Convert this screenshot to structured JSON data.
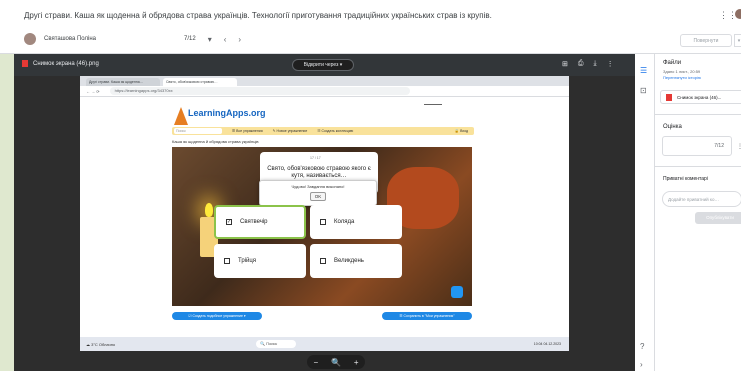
{
  "header": {
    "title": "Другі страви. Каша як щоденна й обрядова страва українців. Технології приготування традиційних українських страв із крупів.",
    "student": "Святашова Поліна",
    "counter": "7/12",
    "return_label": "Повернути",
    "dropdown": "▾",
    "apps_icon": "⋮⋮"
  },
  "viewer": {
    "file_name": "Снимок экрана (46).png",
    "open_with": "Відкрити через ▾",
    "icons": [
      "⊞",
      "⎙",
      "⤓",
      "⋮"
    ],
    "zoom": {
      "minus": "−",
      "icon": "🔍",
      "plus": "+"
    }
  },
  "screenshot": {
    "tabs": [
      "Другі страви. Каша як щоденна…",
      "Свято, обов'язковою стравою…"
    ],
    "url": "https://learningapps.org/34370xx",
    "logo": "LearningApps.org",
    "flags": "▬▬▬▬▬▬",
    "search_placeholder": "Поиск",
    "menu": [
      "☰ Все упражнения",
      "✎ Новое упражнение",
      "☷ Создать коллекцию",
      "🔒 Вход"
    ],
    "activity_title": "Каша як щоденна й обрядова страва українців",
    "question_number": "17 / 17",
    "question": "Свято, обов'язковою стравою якого є кутя, називається…",
    "popup_text": "Чудово! Завдання виконано!",
    "popup_ok": "OK",
    "answers": [
      {
        "label": "Святвечір",
        "selected": true,
        "mark": "✓"
      },
      {
        "label": "Коляда",
        "selected": false,
        "mark": ""
      },
      {
        "label": "Трійця",
        "selected": false,
        "mark": ""
      },
      {
        "label": "Великдень",
        "selected": false,
        "mark": ""
      }
    ],
    "button_similar": "☑ Создать подобное упражнение ▾",
    "button_save": "☰ Сохранить в \"Мои упражнения\"",
    "taskbar_weather": "☁ 3°C Облачно",
    "taskbar_search": "🔍 Поиск",
    "taskbar_clock": "10:04 04.12.2023"
  },
  "rail": {
    "icons": [
      "☰",
      "⊡",
      "?",
      "›"
    ]
  },
  "panel": {
    "files_heading": "Файли",
    "files_meta": "Здано 1 лист., 20:59",
    "files_history": "Переглянути історію",
    "attachment": "Снимок экрана (46)...",
    "grade_heading": "Оцінка",
    "grade_value": "7/12",
    "grade_more": "⋮",
    "comments_heading": "Приватні коментарі",
    "comments_placeholder": "Додайте приватний ко…",
    "send_label": "Опублікувати"
  }
}
